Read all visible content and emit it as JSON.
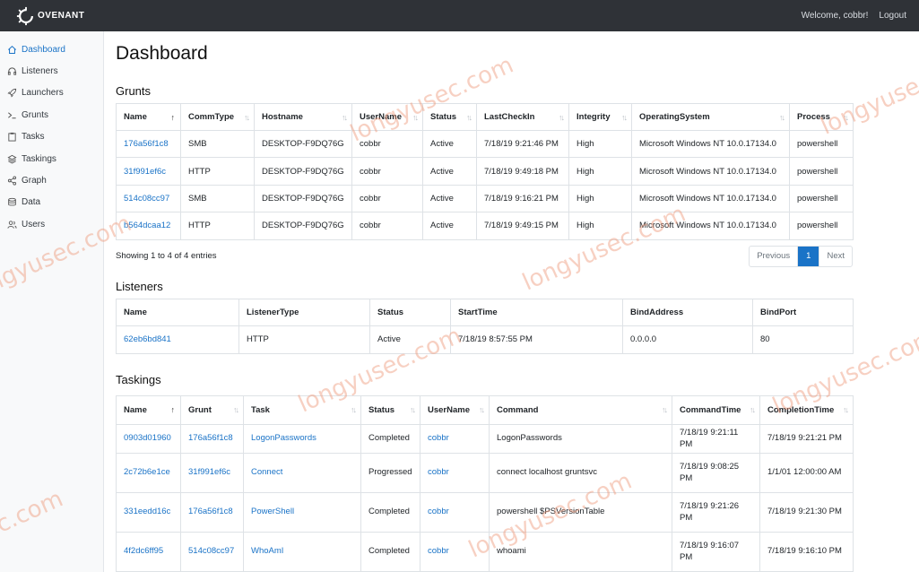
{
  "brand": {
    "name": "OVENANT",
    "logo_icon": "covenant-gear-icon"
  },
  "header": {
    "welcome": "Welcome, cobbr!",
    "logout": "Logout"
  },
  "sidebar": {
    "items": [
      {
        "label": "Dashboard",
        "icon": "home-icon",
        "active": true
      },
      {
        "label": "Listeners",
        "icon": "headphones-icon"
      },
      {
        "label": "Launchers",
        "icon": "rocket-icon"
      },
      {
        "label": "Grunts",
        "icon": "terminal-icon"
      },
      {
        "label": "Tasks",
        "icon": "clipboard-icon"
      },
      {
        "label": "Taskings",
        "icon": "layers-icon"
      },
      {
        "label": "Graph",
        "icon": "share-icon"
      },
      {
        "label": "Data",
        "icon": "database-icon"
      },
      {
        "label": "Users",
        "icon": "users-icon"
      }
    ]
  },
  "page": {
    "title": "Dashboard"
  },
  "grunts": {
    "title": "Grunts",
    "columns": [
      "Name",
      "CommType",
      "Hostname",
      "UserName",
      "Status",
      "LastCheckIn",
      "Integrity",
      "OperatingSystem",
      "Process"
    ],
    "rows": [
      [
        "176a56f1c8",
        "SMB",
        "DESKTOP-F9DQ76G",
        "cobbr",
        "Active",
        "7/18/19 9:21:46 PM",
        "High",
        "Microsoft Windows NT 10.0.17134.0",
        "powershell"
      ],
      [
        "31f991ef6c",
        "HTTP",
        "DESKTOP-F9DQ76G",
        "cobbr",
        "Active",
        "7/18/19 9:49:18 PM",
        "High",
        "Microsoft Windows NT 10.0.17134.0",
        "powershell"
      ],
      [
        "514c08cc97",
        "SMB",
        "DESKTOP-F9DQ76G",
        "cobbr",
        "Active",
        "7/18/19 9:16:21 PM",
        "High",
        "Microsoft Windows NT 10.0.17134.0",
        "powershell"
      ],
      [
        "b564dcaa12",
        "HTTP",
        "DESKTOP-F9DQ76G",
        "cobbr",
        "Active",
        "7/18/19 9:49:15 PM",
        "High",
        "Microsoft Windows NT 10.0.17134.0",
        "powershell"
      ]
    ],
    "info": "Showing 1 to 4 of 4 entries",
    "pagination": {
      "previous": "Previous",
      "current": "1",
      "next": "Next"
    }
  },
  "listeners": {
    "title": "Listeners",
    "columns": [
      "Name",
      "ListenerType",
      "Status",
      "StartTime",
      "BindAddress",
      "BindPort"
    ],
    "rows": [
      [
        "62eb6bd841",
        "HTTP",
        "Active",
        "7/18/19 8:57:55 PM",
        "0.0.0.0",
        "80"
      ]
    ]
  },
  "taskings": {
    "title": "Taskings",
    "columns": [
      "Name",
      "Grunt",
      "Task",
      "Status",
      "UserName",
      "Command",
      "CommandTime",
      "CompletionTime"
    ],
    "rows": [
      [
        "0903d01960",
        "176a56f1c8",
        "LogonPasswords",
        "Completed",
        "cobbr",
        "LogonPasswords",
        "7/18/19 9:21:11 PM",
        "7/18/19 9:21:21 PM"
      ],
      [
        "2c72b6e1ce",
        "31f991ef6c",
        "Connect",
        "Progressed",
        "cobbr",
        "connect localhost gruntsvc",
        "7/18/19 9:08:25 PM",
        "1/1/01 12:00:00 AM"
      ],
      [
        "331eedd16c",
        "176a56f1c8",
        "PowerShell",
        "Completed",
        "cobbr",
        "powershell $PSVersionTable",
        "7/18/19 9:21:26 PM",
        "7/18/19 9:21:30 PM"
      ],
      [
        "4f2dc6ff95",
        "514c08cc97",
        "WhoAmI",
        "Completed",
        "cobbr",
        "whoami",
        "7/18/19 9:16:07 PM",
        "7/18/19 9:16:10 PM"
      ]
    ]
  },
  "watermark": {
    "text": "longyusec.com",
    "fragment_right": "longyuse",
    "fragment_left": "ngyusec.com",
    "fragment_left2": "c.com"
  },
  "colors": {
    "accent": "#1a73c7",
    "topbar": "#2f3237",
    "watermark": "#ee9678"
  }
}
